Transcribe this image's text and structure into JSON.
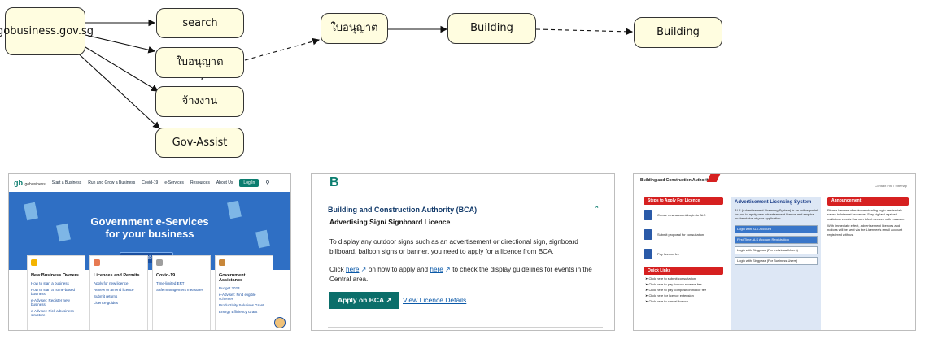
{
  "diagram": {
    "nodes": {
      "gobusiness": "gobusiness.gov.sg",
      "search": "search",
      "licence": "ใบอนุญาต",
      "hire": "จ้างงาน",
      "gov_assist": "Gov-Assist",
      "licence_mid": "ใบอนุญาต",
      "building_1": "Building",
      "building_2": "Building"
    },
    "colors": {
      "node_fill": "#fffde0",
      "node_border": "#333333",
      "edge": "#111111"
    }
  },
  "screenshots": {
    "gobusiness": {
      "logo": "gobusiness",
      "nav": [
        "Start a Business",
        "Run and Grow a Business",
        "Covid-19",
        "e-Services",
        "Resources",
        "About Us"
      ],
      "login": "Log In",
      "hero_title_1": "Government e-Services",
      "hero_title_2": "for your business",
      "hero_button": "Log in to GoBusiness",
      "cards": [
        {
          "title": "New Business Owners",
          "links": [
            "How to start a business",
            "How to start a home-based business",
            "e-Adviser: Register new business",
            "e-Adviser: Pick a business structure"
          ]
        },
        {
          "title": "Licences and Permits",
          "links": [
            "Apply for new licence",
            "Renew or amend licence",
            "Submit returns",
            "Licence guides"
          ]
        },
        {
          "title": "Covid-19",
          "links": [
            "Time-limited ERT",
            "Safe management measures"
          ]
        },
        {
          "title": "Government Assistance",
          "links": [
            "Budget 2023",
            "e-Adviser: Find eligible schemes",
            "Productivity Solutions Grant",
            "Energy Efficiency Grant"
          ]
        }
      ]
    },
    "bca": {
      "letter": "B",
      "agency": "Building and Construction Authority (BCA)",
      "subtitle": "Advertising Sign/ Signboard Licence",
      "para1": "To display any outdoor signs such as an advertisement or directional sign, signboard billboard, balloon signs or banner, you need to apply for a licence from BCA.",
      "para2_a": "Click ",
      "para2_link1": "here",
      "para2_b": " on how to apply and ",
      "para2_link2": "here",
      "para2_c": " to check the display guidelines for events in the Central area.",
      "apply_button": "Apply on BCA",
      "view_link": "View Licence Details"
    },
    "als": {
      "org": "Building and Construction",
      "org2": "Authority",
      "utility": "Contact Info / Sitemap",
      "steps_title": "Steps to Apply For Licence",
      "steps": [
        "Create new account/Login to ALS",
        "Submit proposal for consultation",
        "Pay licence fee"
      ],
      "quick_links_title": "Quick Links",
      "quick_links": [
        "Click here to submit consultation",
        "Click here to pay licence renewal fee",
        "Click here to pay composition notice fee",
        "Click here for licence extension",
        "Click here to cancel licence"
      ],
      "system_title": "Advertisement Licensing System",
      "system_desc": "ALS (Advertisement Licensing System) is an online portal for you to apply new advertisement licence and enquire on the status of your application.",
      "login_options": [
        "Login with ALS Account",
        "First Time ALS Account Registration",
        "Login with Singpass (For Individual Users)",
        "Login with Singpass (For Business Users)"
      ],
      "announcement_title": "Announcement",
      "announcement_1": "Please beware of malware stealing login credentials saved in Internet browsers. Stay vigilant against malicious emails that can infect devices with malware.",
      "announcement_2": "With immediate effect, advertisement licences and notices will be sent via the Licensee's email account registered with us."
    }
  }
}
